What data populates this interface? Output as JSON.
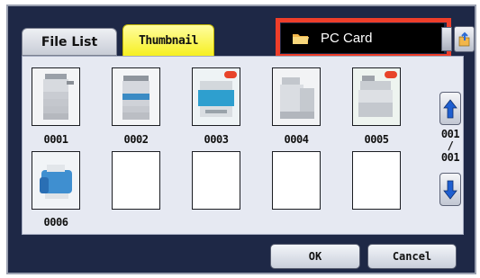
{
  "tabs": {
    "file_list": "File List",
    "thumbnail": "Thumbnail"
  },
  "media": {
    "name": "PC Card",
    "icon": "folder-icon"
  },
  "thumbnails": [
    {
      "label": "0001"
    },
    {
      "label": "0002"
    },
    {
      "label": "0003"
    },
    {
      "label": "0004"
    },
    {
      "label": "0005"
    },
    {
      "label": "0006"
    },
    {
      "label": ""
    },
    {
      "label": ""
    },
    {
      "label": ""
    },
    {
      "label": ""
    }
  ],
  "pager": {
    "current": "001",
    "separator": "/",
    "total": "001"
  },
  "buttons": {
    "ok": "OK",
    "cancel": "Cancel"
  },
  "colors": {
    "highlight": "#ee3e2a",
    "active_tab": "#f6ef1e",
    "panel": "#1e2846"
  }
}
